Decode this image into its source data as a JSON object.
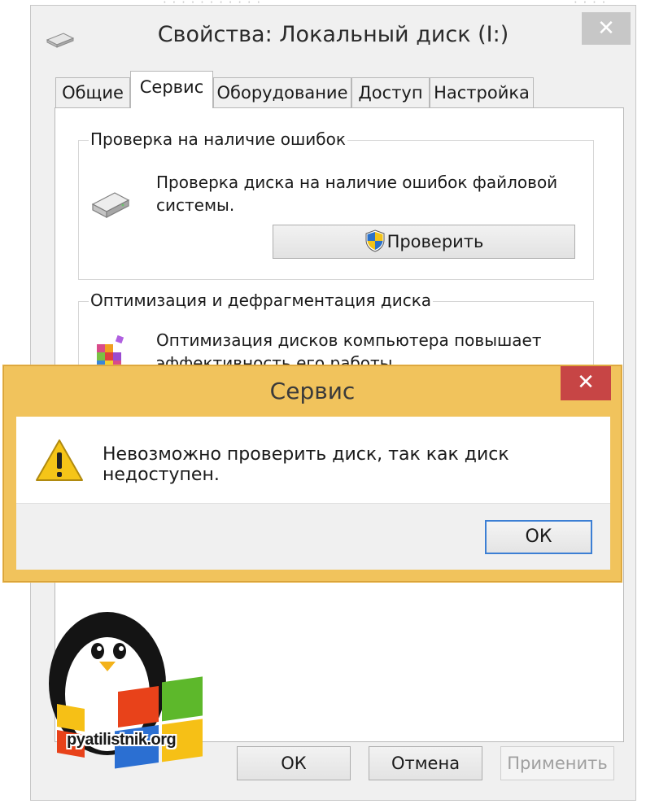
{
  "window": {
    "title": "Свойства: Локальный диск (I:)",
    "close_label": "✕",
    "tabs": [
      {
        "label": "Общие"
      },
      {
        "label": "Сервис"
      },
      {
        "label": "Оборудование"
      },
      {
        "label": "Доступ"
      },
      {
        "label": "Настройка"
      }
    ],
    "active_tab": "Сервис",
    "error_check": {
      "group_label": "Проверка на наличие ошибок",
      "description": "Проверка диска на наличие ошибок файловой системы.",
      "button_label": "Проверить",
      "icon": "drive-icon",
      "button_icon": "uac-shield-icon"
    },
    "optimize": {
      "group_label": "Оптимизация и дефрагментация диска",
      "description": "Оптимизация дисков компьютера повышает эффективность его работы.",
      "icon": "defrag-icon"
    },
    "buttons": {
      "ok": "ОК",
      "cancel": "Отмена",
      "apply": "Применить"
    }
  },
  "dialog": {
    "title": "Сервис",
    "close_label": "✕",
    "message": "Невозможно проверить диск, так как диск недоступен.",
    "ok_label": "ОК",
    "icon": "warning-icon",
    "frame_color": "#f1c35c",
    "close_color": "#c74545"
  },
  "watermark": {
    "text": "pyatilistnik.org",
    "icon": "penguin-windows-logo"
  },
  "accent_focus": "#3c7fd4"
}
